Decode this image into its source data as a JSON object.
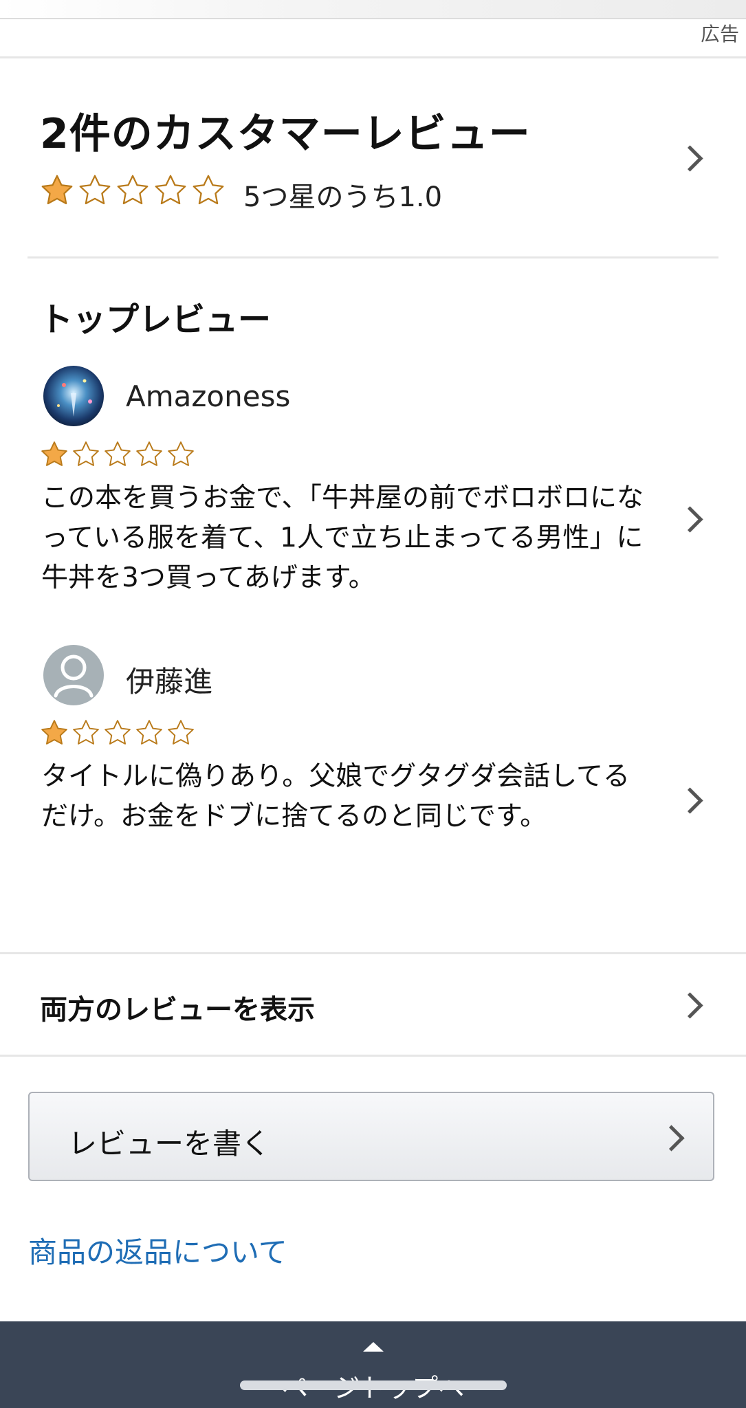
{
  "top_ad": {
    "label": "広告"
  },
  "summary": {
    "title": "2件のカスタマーレビュー",
    "rating_text": "5つ星のうち1.0",
    "rating": 1,
    "max_rating": 5
  },
  "top_reviews": {
    "heading": "トップレビュー",
    "reviews": [
      {
        "author": "Amazoness",
        "rating": 1,
        "text": "この本を買うお金で、「牛丼屋の前でボロボロになっている服を着て、1人で立ち止まってる男性」に牛丼を3つ買ってあげます。"
      },
      {
        "author": "伊藤進",
        "rating": 1,
        "text": "タイトルに偽りあり。父娘でグタグダ会話してるだけ。お金をドブに捨てるのと同じです。"
      }
    ]
  },
  "show_all": {
    "label": "両方のレビューを表示"
  },
  "write_review": {
    "label": "レビューを書く"
  },
  "returns_link": {
    "label": "商品の返品について"
  },
  "footer": {
    "back_to_top": "ページトップへ"
  },
  "colors": {
    "star_fill": "#f3a847",
    "link": "#1f6db5",
    "footer_bg": "#3a4556"
  }
}
